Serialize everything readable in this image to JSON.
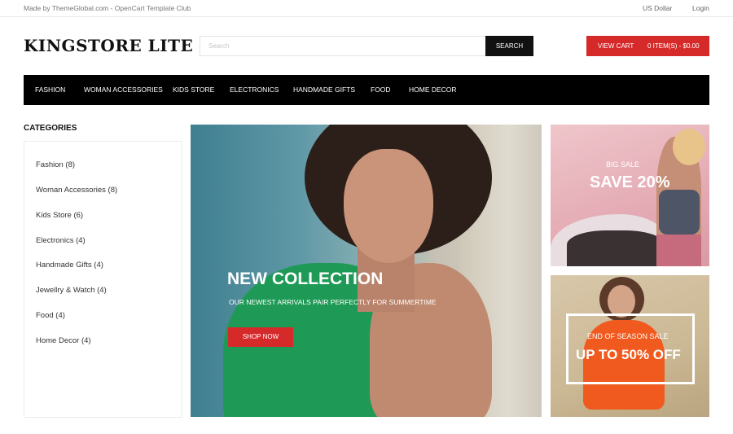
{
  "topbar": {
    "credit": "Made by ThemeGlobal.com - OpenCart Template Club",
    "currency": "US Dollar",
    "login": "Login"
  },
  "header": {
    "logo": "KINGSTORE LITE",
    "search_placeholder": "Search",
    "search_button": "SEARCH",
    "cart_label": "VIEW CART",
    "cart_items": "0 ITEM(S) - $0.00"
  },
  "nav": {
    "items": [
      "FASHION",
      "WOMAN ACCESSORIES",
      "KIDS STORE",
      "ELECTRONICS",
      "HANDMADE GIFTS",
      "FOOD",
      "HOME DECOR"
    ]
  },
  "sidebar": {
    "title": "CATEGORIES",
    "items": [
      "Fashion (8)",
      "Woman Accessories (8)",
      "Kids Store (6)",
      "Electronics (4)",
      "Handmade Gifts (4)",
      "Jewellry & Watch (4)",
      "Food (4)",
      "Home Decor (4)"
    ]
  },
  "main_banner": {
    "headline": "NEW COLLECTION",
    "subtitle": "OUR NEWEST ARRIVALS PAIR PERFECTLY FOR SUMMERTIME",
    "button": "SHOP NOW"
  },
  "side_banners": [
    {
      "small": "BIG SALE",
      "big": "SAVE 20%"
    },
    {
      "small": "END OF SEASON SALE",
      "big": "UP TO 50% OFF"
    }
  ],
  "colors": {
    "accent": "#d62a2a",
    "nav_bg": "#000000",
    "text": "#333333"
  }
}
